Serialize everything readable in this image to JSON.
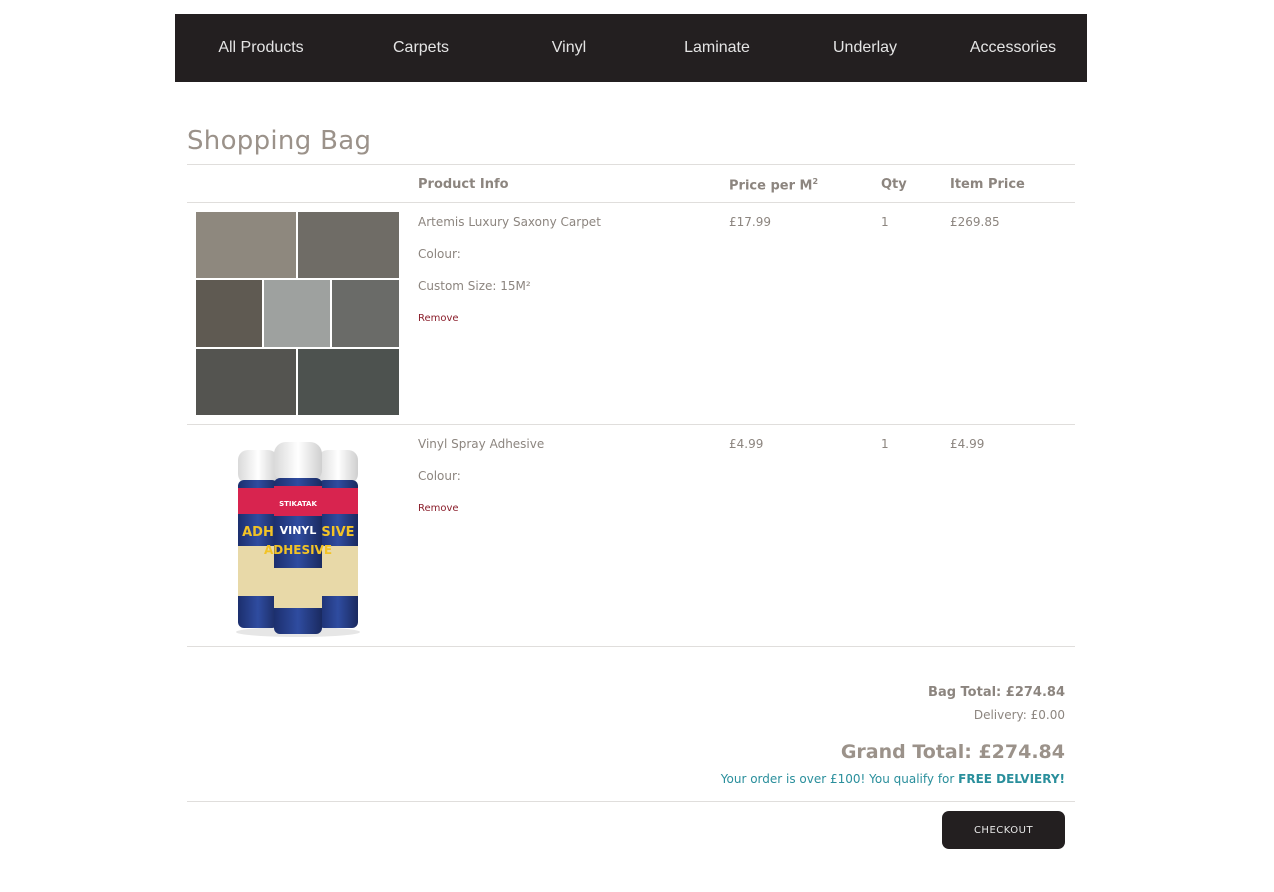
{
  "nav": {
    "items": [
      "All Products",
      "Carpets",
      "Vinyl",
      "Laminate",
      "Underlay",
      "Accessories"
    ]
  },
  "page_title": "Shopping Bag",
  "table": {
    "headers": {
      "product_info": "Product Info",
      "price_per": "Price per M",
      "price_per_sup": "2",
      "qty": "Qty",
      "item_price": "Item Price"
    },
    "rows": [
      {
        "name": "Artemis Luxury Saxony Carpet",
        "colour": "Colour:",
        "custom_size": "Custom Size: 15M²",
        "remove": "Remove",
        "price": "£17.99",
        "qty": "1",
        "item_price": "£269.85"
      },
      {
        "name": "Vinyl Spray Adhesive",
        "colour": "Colour:",
        "remove": "Remove",
        "price": "£4.99",
        "qty": "1",
        "item_price": "£4.99"
      }
    ]
  },
  "summary": {
    "bag_total": "Bag Total: £274.84",
    "delivery": "Delivery: £0.00",
    "grand_total": "Grand Total: £274.84",
    "free_delivery_msg": "Your order is over £100! You qualify for ",
    "free_delivery_strong": "FREE DELVIERY!"
  },
  "checkout_label": "CHECKOUT",
  "colors": {
    "nav_bg": "#231f20",
    "text": "#8c857f",
    "remove": "#8b1f2c",
    "promo": "#2a8f9c"
  },
  "product_images": {
    "carpet": "carpet-swatches",
    "spray": "spray-cans",
    "can_label": "STIKATAK"
  }
}
